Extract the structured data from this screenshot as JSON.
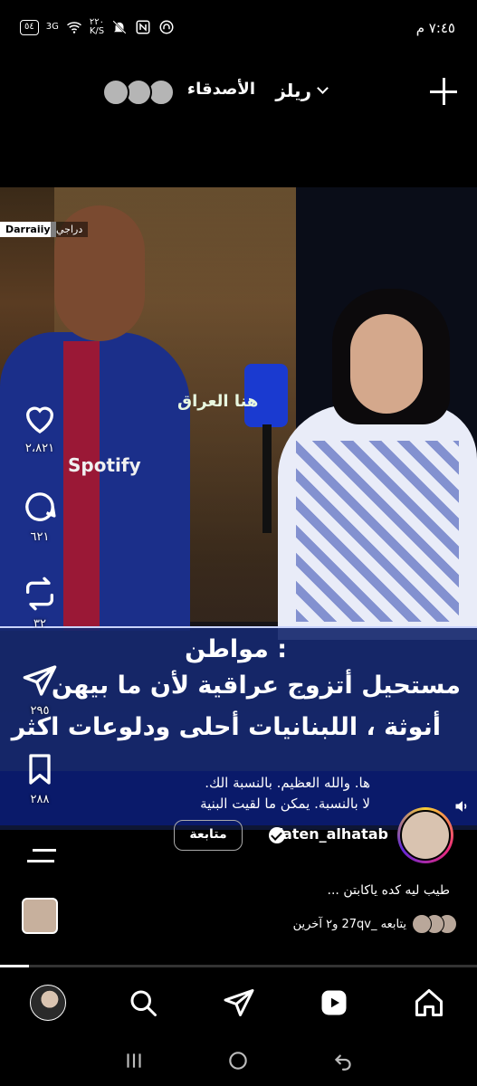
{
  "status_bar": {
    "time": "٧:٤٥ م",
    "battery": "٥٤",
    "network": "3G",
    "speed": "٢٢٠\nK/S",
    "icons": [
      "battery-icon",
      "signal-icon",
      "wifi-icon",
      "data-speed",
      "mute-icon",
      "nfc-icon",
      "headset-icon"
    ]
  },
  "header": {
    "tab_reels": "ريلز",
    "tab_friends": "الأصدقاء",
    "create_icon": "plus-icon"
  },
  "video": {
    "brand_badge": "Darraiiy",
    "brand_label": "دراجي",
    "channel_logo": "هنا العراق",
    "sponsor": "Spotify",
    "caption_title": "مواطن :",
    "caption_line1": "مستحيل أتزوج عراقية لأن ما بيهن",
    "caption_line2": "أنوثة ، اللبنانيات أحلى ودلوعات اكثر",
    "subtitle_line1": "ها. والله العظيم. بالنسبة الك.",
    "subtitle_line2": "لا بالنسبة. يمكن ما لقيت البنية"
  },
  "actions": {
    "likes": "٢،٨٢١",
    "comments": "٦٢١",
    "reposts": "٣٢",
    "shares": "٢٩٥",
    "saves": "٢٨٨"
  },
  "author": {
    "username": "faten_alhatab",
    "follow_label": "متابعة",
    "caption": "طيب ليه كده ياكابتن ...",
    "followed_by": "يتابعه _27qv و٢ آخرين"
  },
  "playback": {
    "progress": 0.06
  },
  "bottom_nav": {
    "items": [
      "home-icon",
      "reels-icon",
      "send-icon",
      "search-icon",
      "profile-avatar"
    ]
  },
  "colors": {
    "background": "#000000",
    "caption_panel": "#16286e",
    "subtitle_bar": "#0a1a6a",
    "text": "#ffffff"
  }
}
